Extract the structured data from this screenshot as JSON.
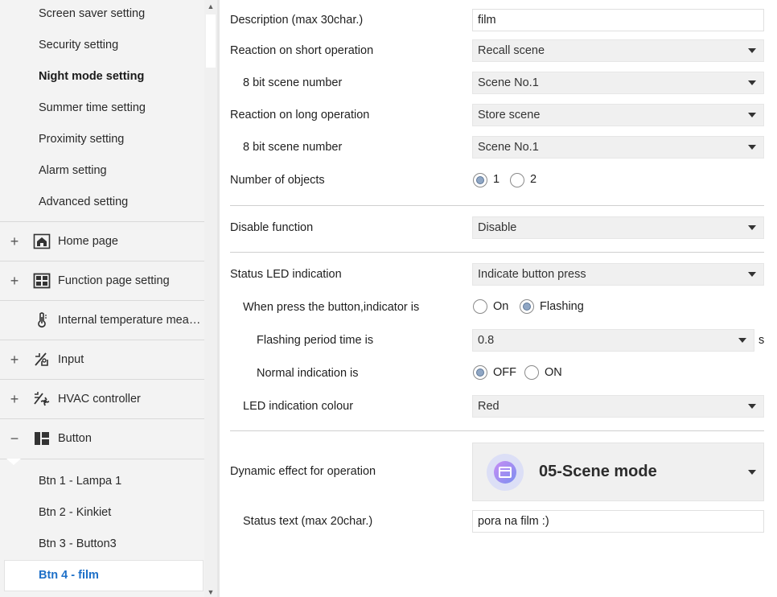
{
  "sidebar": {
    "sub_items": [
      "Screen saver setting",
      "Security setting",
      "Night mode setting",
      "Summer time setting",
      "Proximity setting",
      "Alarm setting",
      "Advanced setting"
    ],
    "tree_items": [
      {
        "expander": "+",
        "icon": "home-icon",
        "label": "Home page"
      },
      {
        "expander": "+",
        "icon": "grid-icon",
        "label": "Function page setting"
      },
      {
        "expander": "",
        "icon": "thermometer-icon",
        "label": "Internal temperature meas..."
      },
      {
        "expander": "+",
        "icon": "input-icon",
        "label": "Input"
      },
      {
        "expander": "+",
        "icon": "hvac-icon",
        "label": "HVAC controller"
      },
      {
        "expander": "−",
        "icon": "layout-icon",
        "label": "Button"
      }
    ],
    "children": [
      "Btn 1 - Lampa 1",
      "Btn 2 - Kinkiet",
      "Btn 3 - Button3",
      "Btn 4 - film"
    ]
  },
  "form": {
    "description": {
      "label": "Description (max 30char.)",
      "value": "film"
    },
    "short_op": {
      "label": "Reaction on short operation",
      "value": "Recall scene"
    },
    "short_scene": {
      "label": "8 bit scene number",
      "value": "Scene No.1"
    },
    "long_op": {
      "label": "Reaction on long operation",
      "value": "Store scene"
    },
    "long_scene": {
      "label": "8 bit scene number",
      "value": "Scene No.1"
    },
    "objects": {
      "label": "Number of objects",
      "options": [
        "1",
        "2"
      ],
      "selected": "1"
    },
    "disable": {
      "label": "Disable function",
      "value": "Disable"
    },
    "status_led": {
      "label": "Status LED indication",
      "value": "Indicate button press"
    },
    "indicator": {
      "label": "When press the button,indicator is",
      "options": [
        "On",
        "Flashing"
      ],
      "selected": "Flashing"
    },
    "flash_period": {
      "label": "Flashing period time is",
      "value": "0.8",
      "unit": "s"
    },
    "normal_ind": {
      "label": "Normal indication is",
      "options": [
        "OFF",
        "ON"
      ],
      "selected": "OFF"
    },
    "led_colour": {
      "label": "LED indication colour",
      "value": "Red"
    },
    "dynamic": {
      "label": "Dynamic effect for operation",
      "value": "05-Scene mode",
      "icon": "scene-clapper-icon"
    },
    "status_text": {
      "label": "Status text (max 20char.)",
      "value": "pora na film :)"
    }
  }
}
